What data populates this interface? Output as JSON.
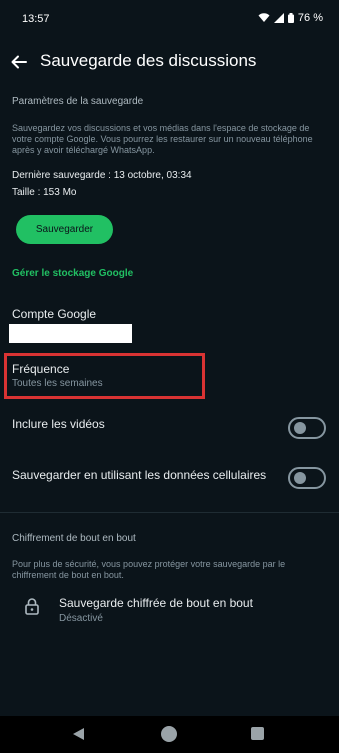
{
  "status": {
    "time": "13:57",
    "battery": "76 %"
  },
  "header": {
    "title": "Sauvegarde des discussions"
  },
  "backup_settings": {
    "section_title": "Paramètres de la sauvegarde",
    "description": "Sauvegardez vos discussions et vos médias dans l'espace de stockage de votre compte Google. Vous pourrez les restaurer sur un nouveau téléphone après y avoir téléchargé WhatsApp.",
    "last_backup": "Dernière sauvegarde : 13 octobre, 03:34",
    "size": "Taille : 153 Mo",
    "backup_button": "Sauvegarder",
    "manage_storage_link": "Gérer le stockage Google"
  },
  "google_account": {
    "label": "Compte Google"
  },
  "frequency": {
    "label": "Fréquence",
    "value": "Toutes les semaines"
  },
  "include_videos": {
    "label": "Inclure les vidéos",
    "enabled": false
  },
  "cellular_backup": {
    "label": "Sauvegarder en utilisant les données cellulaires",
    "enabled": false
  },
  "encryption": {
    "section_title": "Chiffrement de bout en bout",
    "description": "Pour plus de sécurité, vous pouvez protéger votre sauvegarde par le chiffrement de bout en bout.",
    "item_label": "Sauvegarde chiffrée de bout en bout",
    "item_status": "Désactivé"
  },
  "colors": {
    "background": "#0b141a",
    "accent_green": "#21c063",
    "highlight_red": "#d93333"
  }
}
